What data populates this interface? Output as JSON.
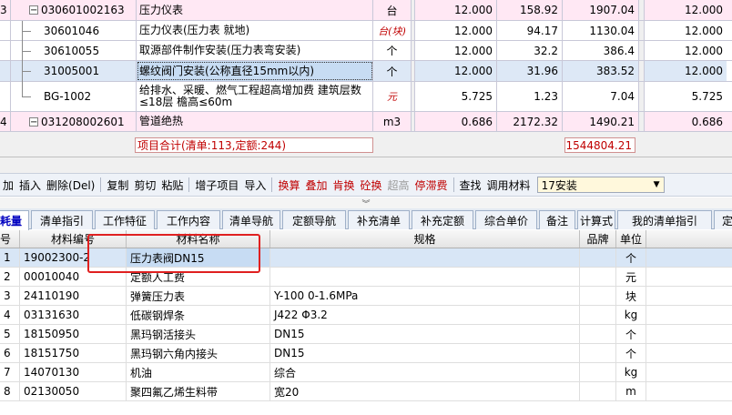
{
  "top_rows": [
    {
      "row_no": "3",
      "code": "030601002163",
      "name": "压力仪表",
      "unit": "台",
      "qty": "12.000",
      "price": "158.92",
      "total": "1907.04",
      "qty2": "12.000",
      "level": 0,
      "pink": true
    },
    {
      "row_no": "",
      "code": "30601046",
      "name": "压力仪表(压力表 就地)",
      "unit": "台(块)",
      "qty": "12.000",
      "price": "94.17",
      "total": "1130.04",
      "qty2": "12.000",
      "level": 1
    },
    {
      "row_no": "",
      "code": "30610055",
      "name": "取源部件制作安装(压力表弯安装)",
      "unit": "个",
      "qty": "12.000",
      "price": "32.2",
      "total": "386.4",
      "qty2": "12.000",
      "level": 1
    },
    {
      "row_no": "",
      "code": "31005001",
      "name": "螺纹阀门安装(公称直径15mm以内)",
      "unit": "个",
      "qty": "12.000",
      "price": "31.96",
      "total": "383.52",
      "qty2": "12.000",
      "level": 1,
      "selected": true
    },
    {
      "row_no": "",
      "code": "BG-1002",
      "name": "给排水、采暖、燃气工程超高增加费 建筑层数≤18层 檐高≤60m",
      "unit": "元",
      "qty": "5.725",
      "price": "1.23",
      "total": "7.04",
      "qty2": "5.725",
      "level": 1,
      "last": true
    },
    {
      "row_no": "4",
      "code": "031208002601",
      "name": "管道绝热",
      "unit": "m3",
      "qty": "0.686",
      "price": "2172.32",
      "total": "1490.21",
      "qty2": "0.686",
      "level": 0,
      "pink": true
    }
  ],
  "summary": {
    "label": "项目合计(清单:113,定额:244)",
    "total": "1544804.21"
  },
  "toolbar": {
    "items": [
      {
        "label": "加",
        "style": ""
      },
      {
        "label": "插入",
        "style": ""
      },
      {
        "label": "删除(Del)",
        "style": ""
      },
      {
        "sep": true
      },
      {
        "label": "复制",
        "style": ""
      },
      {
        "label": "剪切",
        "style": ""
      },
      {
        "label": "粘贴",
        "style": ""
      },
      {
        "sep": true
      },
      {
        "label": "增子项目",
        "style": ""
      },
      {
        "label": "导入",
        "style": ""
      },
      {
        "sep": true
      },
      {
        "label": "换算",
        "style": "red"
      },
      {
        "label": "叠加",
        "style": "red"
      },
      {
        "label": "肯换",
        "style": "red"
      },
      {
        "label": "砼换",
        "style": "red"
      },
      {
        "label": "超高",
        "style": "gray"
      },
      {
        "label": "停滞费",
        "style": "red"
      },
      {
        "sep": true
      },
      {
        "label": "查找",
        "style": ""
      },
      {
        "label": "调用材料",
        "style": ""
      }
    ],
    "select_value": "17安装"
  },
  "tabs": [
    "耗量",
    "清单指引",
    "工作特征",
    "工作内容",
    "清单导航",
    "定额导航",
    "补充清单",
    "补充定额",
    "综合单价",
    "备注",
    "计算式",
    "我的清单指引",
    "定"
  ],
  "bottom_headers": {
    "no": "号",
    "code": "材料编号",
    "name": "材料名称",
    "spec": "规格",
    "brand": "品牌",
    "unit": "单位"
  },
  "bottom_rows": [
    {
      "no": "1",
      "code": "19002300-2",
      "name": "压力表阀DN15",
      "spec": "",
      "brand": "",
      "unit": "个",
      "selected": true
    },
    {
      "no": "2",
      "code": "00010040",
      "name": "定额人工费",
      "spec": "",
      "brand": "",
      "unit": "元"
    },
    {
      "no": "3",
      "code": "24110190",
      "name": "弹簧压力表",
      "spec": "Y-100 0-1.6MPa",
      "brand": "",
      "unit": "块"
    },
    {
      "no": "4",
      "code": "03131630",
      "name": "低碳钢焊条",
      "spec": "J422 Φ3.2",
      "brand": "",
      "unit": "kg"
    },
    {
      "no": "5",
      "code": "18150950",
      "name": "黑玛钢活接头",
      "spec": "DN15",
      "brand": "",
      "unit": "个"
    },
    {
      "no": "6",
      "code": "18151750",
      "name": "黑玛钢六角内接头",
      "spec": "DN15",
      "brand": "",
      "unit": "个"
    },
    {
      "no": "7",
      "code": "14070130",
      "name": "机油",
      "spec": "综合",
      "brand": "",
      "unit": "kg"
    },
    {
      "no": "8",
      "code": "02130050",
      "name": "聚四氟乙烯生料带",
      "spec": "宽20",
      "brand": "",
      "unit": "m"
    }
  ]
}
